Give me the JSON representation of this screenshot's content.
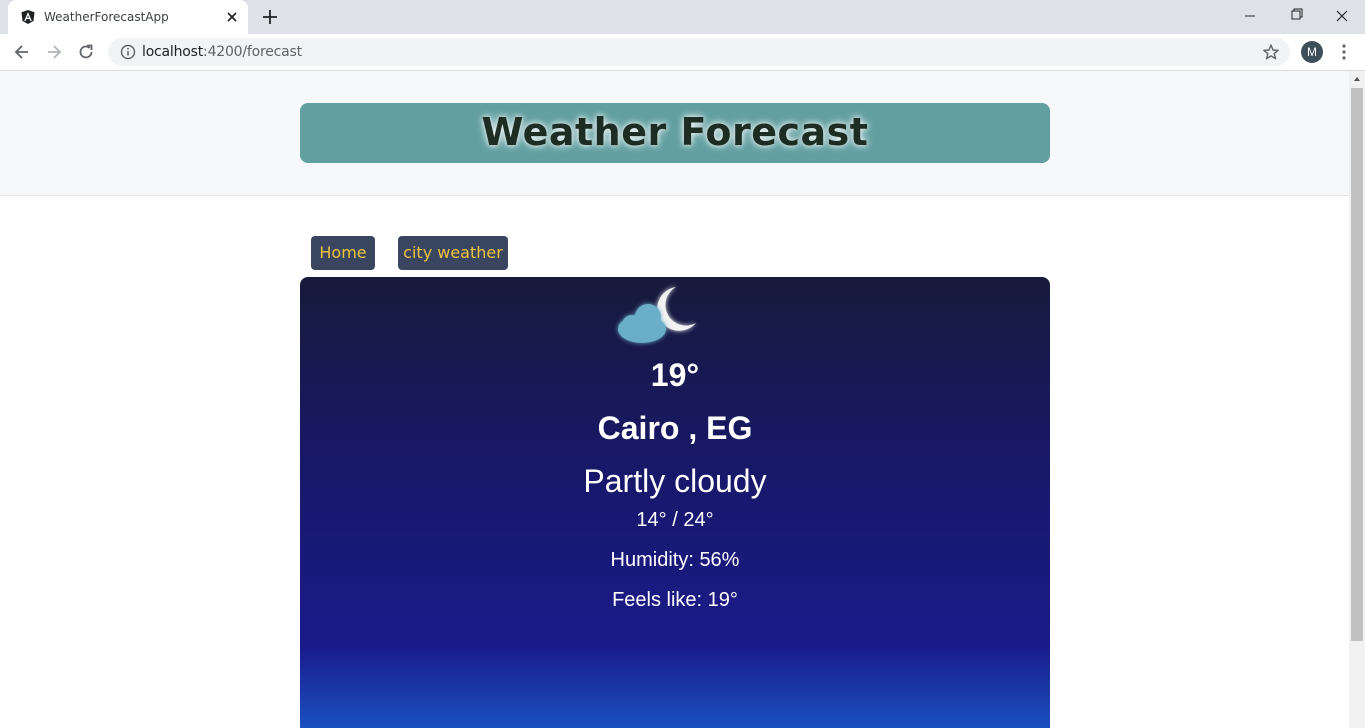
{
  "browser": {
    "tab_title": "WeatherForecastApp",
    "url_host": "localhost",
    "url_path": ":4200/forecast",
    "profile_initial": "M"
  },
  "page": {
    "title": "Weather Forecast",
    "nav": {
      "home": "Home",
      "city_weather": "city weather"
    }
  },
  "weather": {
    "icon": "partly-cloudy-night-icon",
    "temperature": "19°",
    "location": "Cairo , EG",
    "condition": "Partly cloudy",
    "range": "14° / 24°",
    "humidity": "Humidity: 56%",
    "feels_like": "Feels like: 19°"
  },
  "colors": {
    "title_bg": "#619fa0",
    "nav_bg": "#3a4660",
    "nav_text": "#f0c33c",
    "card_top": "#171a3a",
    "card_bottom": "#1a56c6"
  }
}
